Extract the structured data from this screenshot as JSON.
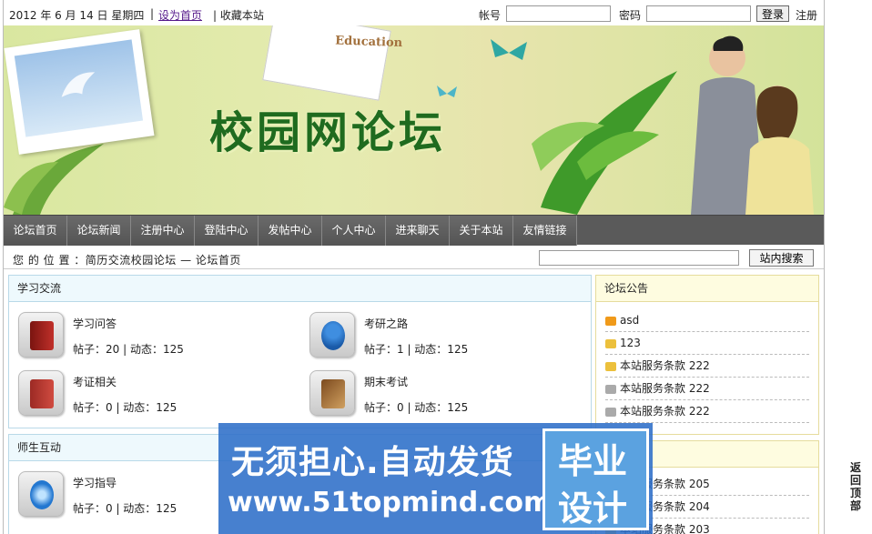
{
  "topbar": {
    "date": "2012 年 6 月 14 日 星期四",
    "separator": "|",
    "set_home": "设为首页",
    "favorite": "| 收藏本站",
    "account_label": "帐号",
    "password_label": "密码",
    "login_button": "登录",
    "register_link": "注册"
  },
  "banner": {
    "site_title": "校园网论坛",
    "card_text": "Education"
  },
  "nav": {
    "items": [
      "论坛首页",
      "论坛新闻",
      "注册中心",
      "登陆中心",
      "发帖中心",
      "个人中心",
      "进来聊天",
      "关于本站",
      "友情链接"
    ]
  },
  "location": {
    "text": "您 的 位 置 ：简历交流校园论坛 — 论坛首页",
    "search_button": "站内搜索"
  },
  "study": {
    "title": "学习交流",
    "forums": [
      {
        "name": "学习问答",
        "stats": "帖子：20 | 动态：125",
        "icon": "book-icon"
      },
      {
        "name": "考研之路",
        "stats": "帖子：1 | 动态：125",
        "icon": "user-icon"
      },
      {
        "name": "考证相关",
        "stats": "帖子：0 | 动态：125",
        "icon": "dictionary-icon"
      },
      {
        "name": "期末考试",
        "stats": "帖子：0 | 动态：125",
        "icon": "notebook-icon"
      }
    ]
  },
  "teach": {
    "title": "师生互动",
    "forums": [
      {
        "name": "学习指导",
        "stats": "帖子：0 | 动态：125",
        "icon": "swirl-icon"
      }
    ]
  },
  "notice": {
    "title": "论坛公告",
    "items": [
      "asd",
      "123",
      "本站服务条款  222",
      "本站服务条款  222",
      "本站服务条款  222"
    ]
  },
  "notice2": {
    "items": [
      "本站服务条款  205",
      "本站服务条款  204",
      "本站服务条款  203"
    ]
  },
  "side": {
    "back_top": "返回顶部"
  },
  "watermark": {
    "line1": "无须担心.自动发货",
    "line2": "www.51topmind.com",
    "box1": "毕业",
    "box2": "设计"
  },
  "colors": {
    "nav_bg": "#5a5a5a",
    "panel_header": "#eef9fd",
    "notice_header": "#fefce0",
    "title_green": "#1f6b1f",
    "watermark_blue": "#2d6ec8"
  }
}
